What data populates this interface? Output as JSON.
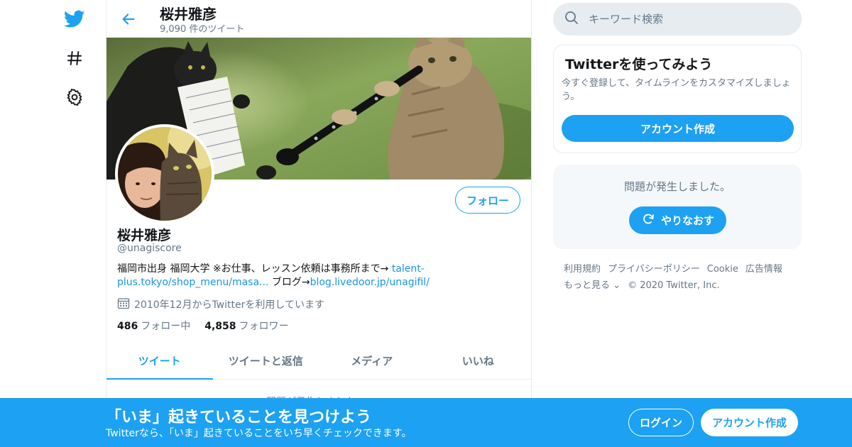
{
  "colors": {
    "accent": "#1da1f2",
    "secondary_text": "#657786",
    "link": "#1b95e0"
  },
  "nav": {
    "icons": [
      "twitter-bird-icon",
      "hashtag-icon",
      "settings-gear-icon"
    ]
  },
  "header": {
    "title": "桜井雅彦",
    "tweet_count": "9,090 件のツイート"
  },
  "profile": {
    "name": "桜井雅彦",
    "handle": "@unagiscore",
    "follow_label": "フォロー",
    "bio_prefix": "福岡市出身 福岡大学 ※お仕事、レッスン依頼は事務所まで→ ",
    "bio_link1": "talent-plus.tokyo/shop_menu/masa...",
    "bio_mid": " ブログ→",
    "bio_link2": "blog.livedoor.jp/unagifil/",
    "joined": "2010年12月からTwitterを利用しています",
    "following_count": "486",
    "following_label": "フォロー中",
    "followers_count": "4,858",
    "followers_label": "フォロワー"
  },
  "tabs": [
    {
      "label": "ツイート",
      "active": true
    },
    {
      "label": "ツイートと返信",
      "active": false
    },
    {
      "label": "メディア",
      "active": false
    },
    {
      "label": "いいね",
      "active": false
    }
  ],
  "timeline_peek": "問題が発生しました。",
  "search": {
    "placeholder": "キーワード検索"
  },
  "signup_card": {
    "title": "Twitterを使ってみよう",
    "desc": "今すぐ登録して、タイムラインをカスタマイズしましょう。",
    "button": "アカウント作成"
  },
  "error_card": {
    "text": "問題が発生しました。",
    "retry_label": "やりなおす"
  },
  "footer": {
    "links": [
      "利用規約",
      "プライバシーポリシー",
      "Cookie",
      "広告情報"
    ],
    "more": "もっと見る",
    "copyright": "© 2020 Twitter, Inc."
  },
  "bottom_bar": {
    "title": "「いま」起きていることを見つけよう",
    "subtitle": "Twitterなら、「いま」起きていることをいち早くチェックできます。",
    "login": "ログイン",
    "signup": "アカウント作成"
  }
}
